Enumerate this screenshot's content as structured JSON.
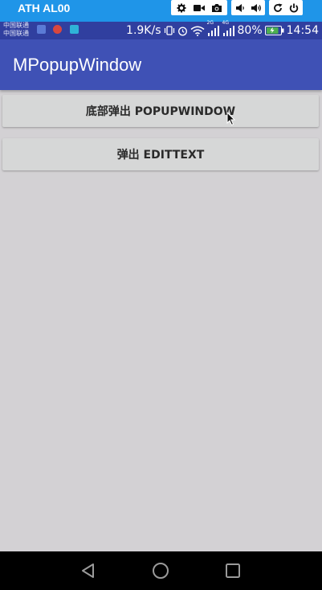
{
  "emulator": {
    "title": "ATH AL00",
    "controls": [
      {
        "name": "settings-icon"
      },
      {
        "name": "video-icon"
      },
      {
        "name": "camera-icon"
      },
      {
        "name": "volume-down-icon"
      },
      {
        "name": "volume-up-icon"
      },
      {
        "name": "rotate-icon"
      },
      {
        "name": "power-icon"
      }
    ]
  },
  "status_bar": {
    "carrier_1": "中国联通",
    "carrier_2": "中国联通",
    "speed": "1.9K/s",
    "network_1": "2G",
    "network_2": "4G",
    "battery": "80%",
    "time": "14:54"
  },
  "app_bar": {
    "title": "MPopupWindow"
  },
  "buttons": {
    "popup_bottom": "底部弹出 POPUPWINDOW",
    "popup_edittext": "弹出 EDITTEXT"
  },
  "nav_bar": {
    "icons": [
      "back-icon",
      "home-icon",
      "recents-icon"
    ]
  },
  "colors": {
    "emulator_bar": "#1f95e8",
    "status_bar": "#303f9f",
    "app_bar": "#3f51b5",
    "background": "#d3d1d4",
    "button": "#d6d7d7"
  }
}
